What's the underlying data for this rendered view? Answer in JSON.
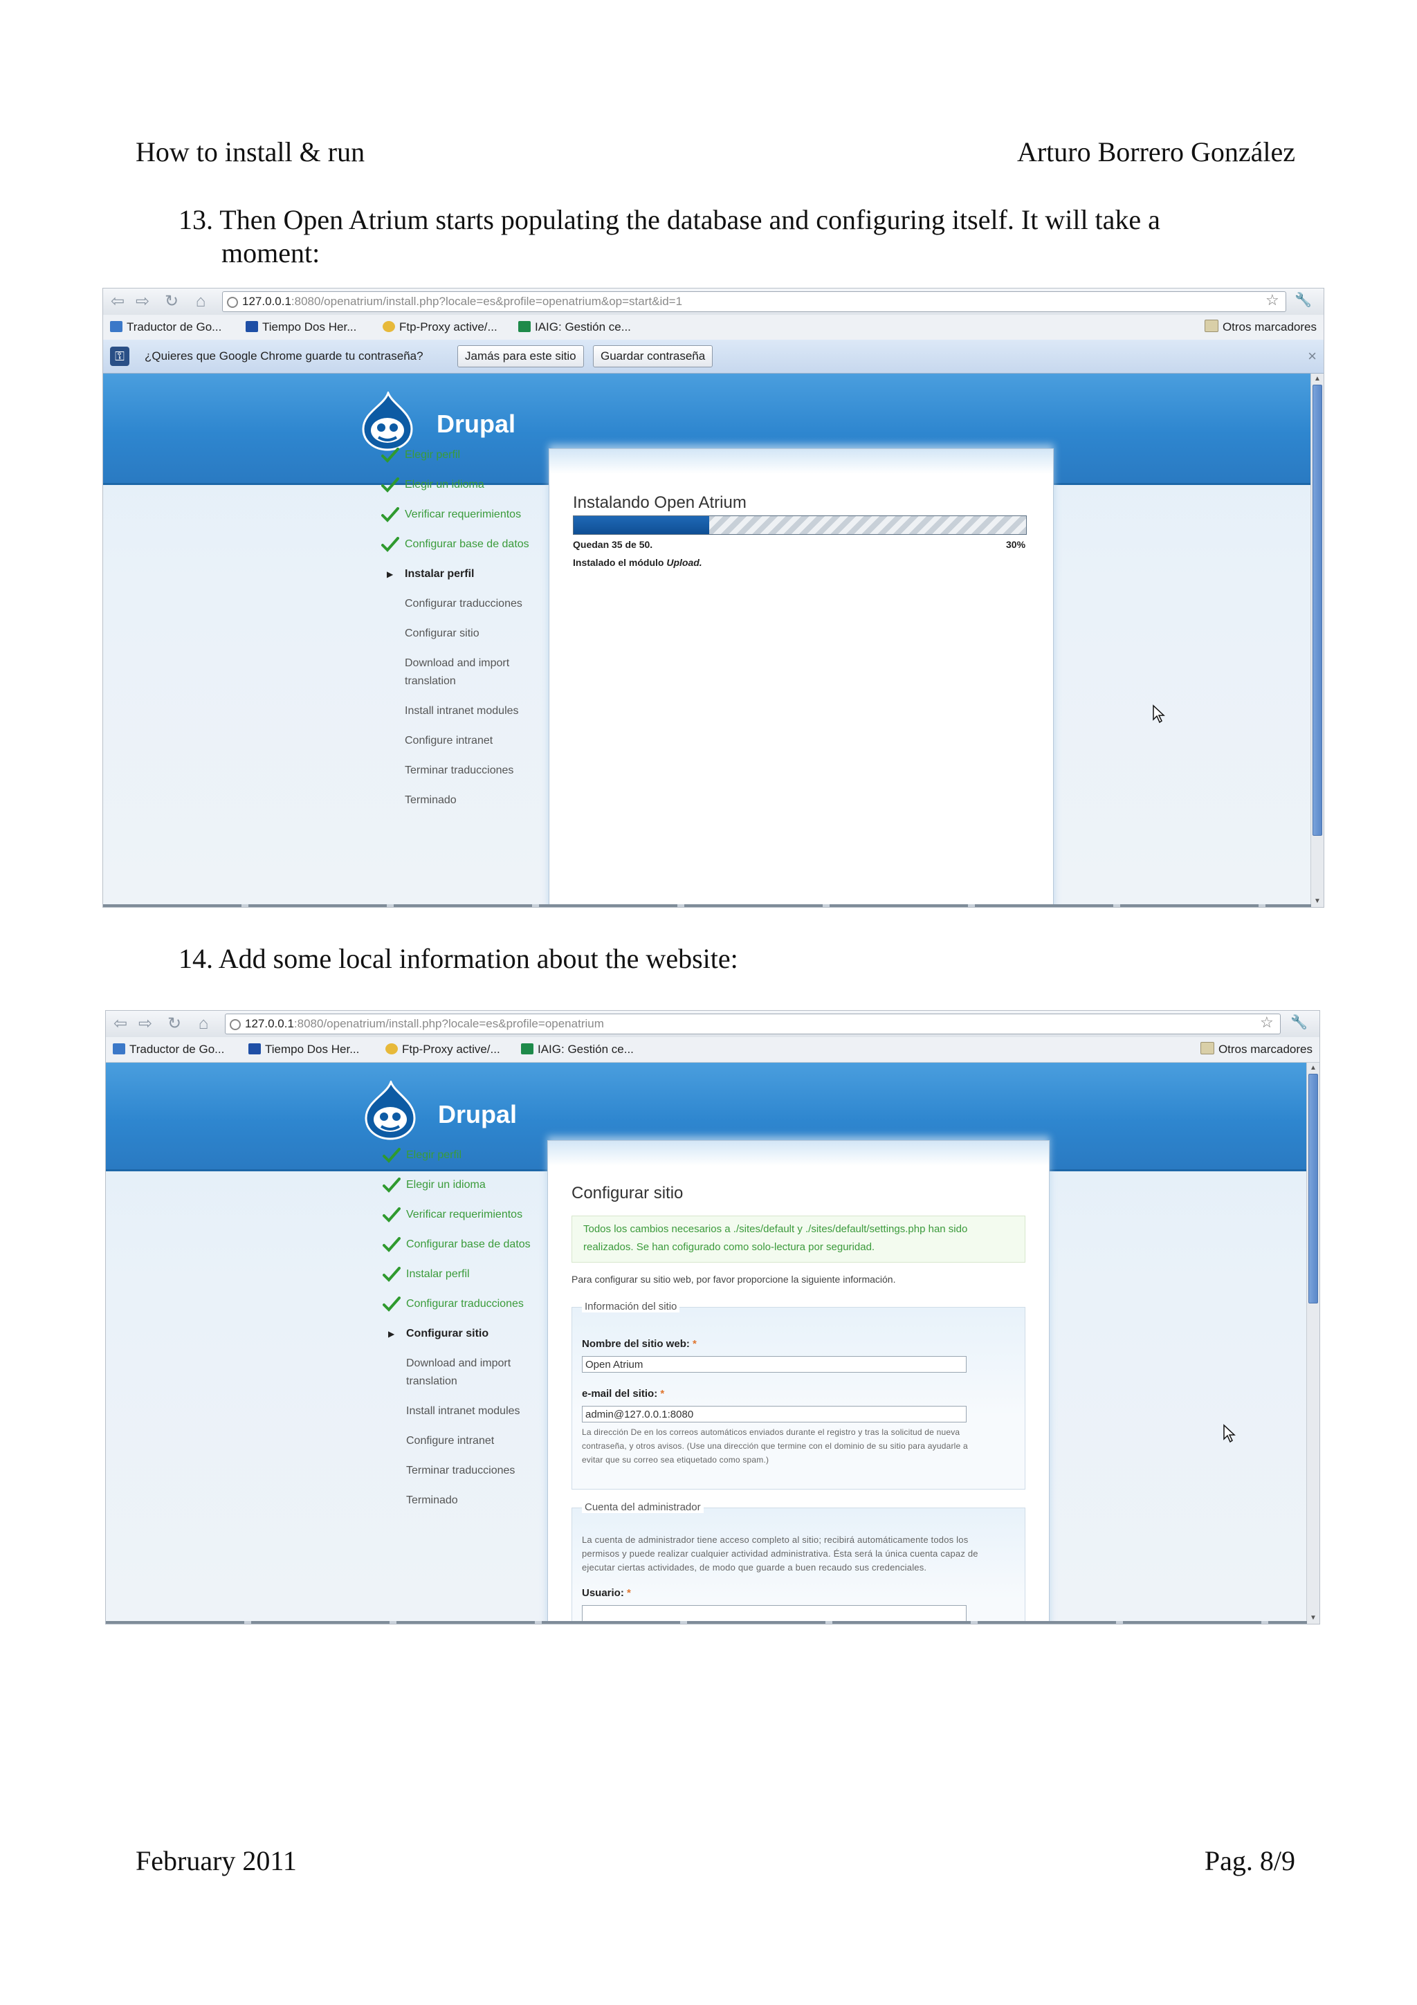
{
  "doc": {
    "header_left": "How to install & run",
    "header_right": "Arturo Borrero González",
    "step13": "13. Then Open Atrium starts populating the database and configuring itself. It will take a moment:",
    "step13_line1": "13. Then Open Atrium starts populating the database and configuring itself. It will take a",
    "step13_line2": "moment:",
    "step14": "14. Add some local information about the website:",
    "footer_left": "February 2011",
    "footer_right": "Pag. 8/9"
  },
  "browser": {
    "bookmarks": [
      "Traductor de Go...",
      "Tiempo Dos Her...",
      "Ftp-Proxy active/...",
      "IAIG: Gestión ce..."
    ],
    "other_bookmarks": "Otros marcadores",
    "colors": {
      "header": "#2e86cf",
      "step_done": "#3a9b3a",
      "progress": "#0f4f94"
    }
  },
  "shot1": {
    "url_host": "127.0.0.1",
    "url_rest": ":8080/openatrium/install.php?locale=es&profile=openatrium&op=start&id=1",
    "password_prompt": "¿Quieres que Google Chrome guarde tu contraseña?",
    "btn_never": "Jamás para este sitio",
    "btn_save": "Guardar contraseña",
    "close": "×",
    "brand": "Drupal",
    "steps": [
      {
        "label": "Elegir perfil",
        "state": "done"
      },
      {
        "label": "Elegir un idioma",
        "state": "done"
      },
      {
        "label": "Verificar requerimientos",
        "state": "done"
      },
      {
        "label": "Configurar base de datos",
        "state": "done"
      },
      {
        "label": "Instalar perfil",
        "state": "current"
      },
      {
        "label": "Configurar traducciones",
        "state": "pending"
      },
      {
        "label": "Configurar sitio",
        "state": "pending"
      },
      {
        "label": "Download and import",
        "state": "pending"
      },
      {
        "label": "translation",
        "state": "pending"
      },
      {
        "label": "Install intranet modules",
        "state": "pending"
      },
      {
        "label": "Configure intranet",
        "state": "pending"
      },
      {
        "label": "Terminar traducciones",
        "state": "pending"
      },
      {
        "label": "Terminado",
        "state": "pending"
      }
    ],
    "title": "Instalando Open Atrium",
    "progress_fraction": 0.3,
    "remaining": "Quedan 35 de 50.",
    "percent": "30%",
    "installed_prefix": "Instalado el módulo ",
    "installed_module": "Upload."
  },
  "shot2": {
    "url_host": "127.0.0.1",
    "url_rest": ":8080/openatrium/install.php?locale=es&profile=openatrium",
    "brand": "Drupal",
    "steps": [
      {
        "label": "Elegir perfil",
        "state": "done"
      },
      {
        "label": "Elegir un idioma",
        "state": "done"
      },
      {
        "label": "Verificar requerimientos",
        "state": "done"
      },
      {
        "label": "Configurar base de datos",
        "state": "done"
      },
      {
        "label": "Instalar perfil",
        "state": "done"
      },
      {
        "label": "Configurar traducciones",
        "state": "done"
      },
      {
        "label": "Configurar sitio",
        "state": "current"
      },
      {
        "label": "Download and import",
        "state": "pending"
      },
      {
        "label": "translation",
        "state": "pending"
      },
      {
        "label": "Install intranet modules",
        "state": "pending"
      },
      {
        "label": "Configure intranet",
        "state": "pending"
      },
      {
        "label": "Terminar traducciones",
        "state": "pending"
      },
      {
        "label": "Terminado",
        "state": "pending"
      }
    ],
    "title": "Configurar sitio",
    "msg_line1": "Todos los cambios necesarios a ./sites/default y ./sites/default/settings.php han sido",
    "msg_line2": "realizados. Se han cofigurado como solo-lectura por seguridad.",
    "intro": "Para configurar su sitio web, por favor proporcione la siguiente información.",
    "fs1_legend": "Información del sitio",
    "site_name_label": "Nombre del sitio web:",
    "site_name_value": "Open Atrium",
    "email_label": "e-mail del sitio:",
    "email_value": "admin@127.0.0.1:8080",
    "email_desc_1": "La dirección De en los correos automáticos enviados durante el registro y tras la solicitud de nueva",
    "email_desc_2": "contraseña, y otros avisos. (Use una dirección que termine con el dominio de su sitio para ayudarle a",
    "email_desc_3": "evitar que su correo sea etiquetado como spam.)",
    "fs2_legend": "Cuenta del administrador",
    "admin_desc_1": "La cuenta de administrador tiene acceso completo al sitio; recibirá automáticamente todos los",
    "admin_desc_2": "permisos y puede realizar cualquier actividad administrativa. Ésta será la única cuenta capaz de",
    "admin_desc_3": "ejecutar ciertas actividades, de modo que guarde a buen recaudo sus credenciales.",
    "user_label": "Usuario:",
    "required_mark": "*"
  }
}
